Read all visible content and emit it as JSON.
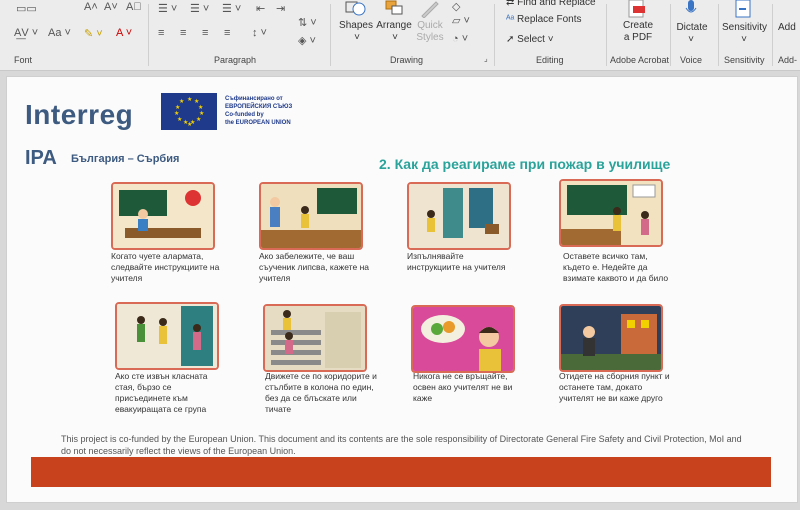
{
  "ribbon": {
    "groups": {
      "font": "Font",
      "paragraph": "Paragraph",
      "drawing": "Drawing",
      "editing": "Editing",
      "adobe": "Adobe Acrobat",
      "voice": "Voice",
      "sensitivity": "Sensitivity",
      "addins": "Add-"
    },
    "drawing": {
      "shapes": "Shapes",
      "arrange": "Arrange",
      "quick_styles": "Quick\nStyles"
    },
    "editing": {
      "find_replace": "Find and Replace",
      "replace_fonts": "Replace Fonts",
      "select": "Select"
    },
    "adobe": {
      "create_pdf": "Create\na PDF"
    },
    "voice": {
      "dictate": "Dictate"
    },
    "sensitivity": {
      "label": "Sensitivity"
    },
    "addins": {
      "label": "Add"
    }
  },
  "document": {
    "logo": "Interreg",
    "eu_text": "Съфинансирано от\nЕВРОПЕЙСКИЯ СЪЮЗ\nCo-funded by\nthe EUROPEAN UNION",
    "ipa": "IPA",
    "ipa_sub": "България – Сърбия",
    "heading": "2. Как да реагираме при пожар в училище",
    "captions": [
      "Когато чуете алармата, следвайте инструкциите на учителя",
      "Ако забележите, че ваш съученик липсва, кажете на учителя",
      "Изпълнявайте инструкциите на учителя",
      "Оставете всичко там, където е. Недейте да взимате каквото и да било",
      "Ако сте извън класната стая, бързо се присъединете към евакуиращата се група",
      "Движете се по коридорите и стълбите в колона по един, без да се блъскате или тичате",
      "Никога не се връщайте, освен ако учителят не ви каже",
      "Отидете на сборния пункт и останете там, докато учителят не ви каже друго"
    ],
    "footer": "This project is co-funded by the European Union. This document and its contents are the sole responsibility of Directorate General Fire Safety and Civil Protection, MoI and do not necessarily reflect the views of the European Union."
  },
  "colors": {
    "brand_blue": "#3d5a80",
    "teal": "#2aa39a",
    "card_border": "#d96a55",
    "footer_bar": "#c8421e"
  }
}
